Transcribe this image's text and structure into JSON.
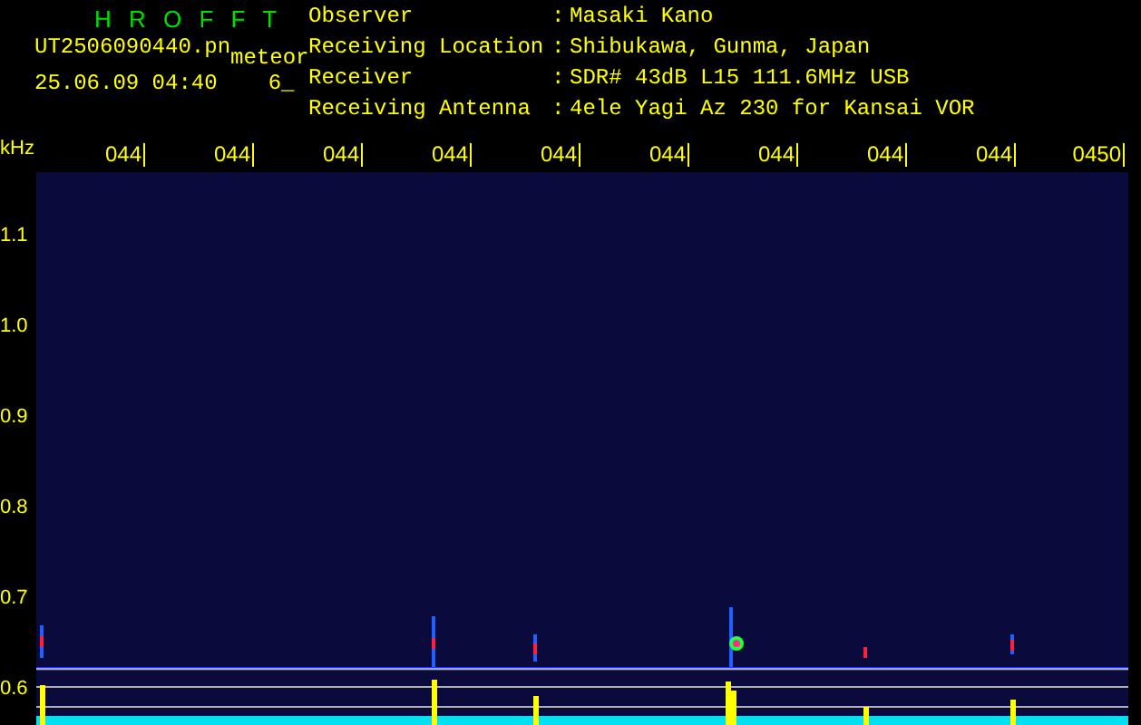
{
  "header": {
    "title": "H R O F F T",
    "filename": "UT2506090440.pn",
    "mode": "meteor",
    "datetime": "25.06.09 04:40",
    "counter": "6_"
  },
  "info": [
    {
      "label": "Observer",
      "separator": ":",
      "value": "Masaki Kano"
    },
    {
      "label": "Receiving Location",
      "separator": ":",
      "value": "Shibukawa, Gunma, Japan"
    },
    {
      "label": "Receiver",
      "separator": ":",
      "value": "SDR# 43dB L15 111.6MHz USB"
    },
    {
      "label": "Receiving Antenna",
      "separator": ":",
      "value": "4ele Yagi Az 230 for Kansai VOR"
    }
  ],
  "axis": {
    "unit": "kHz",
    "time_labels": [
      "044",
      "044",
      "044",
      "044",
      "044",
      "044",
      "044",
      "044",
      "044",
      "0450"
    ],
    "freq_labels": [
      "1.1",
      "1.0",
      "0.9",
      "0.8",
      "0.7",
      "0.6"
    ]
  }
}
